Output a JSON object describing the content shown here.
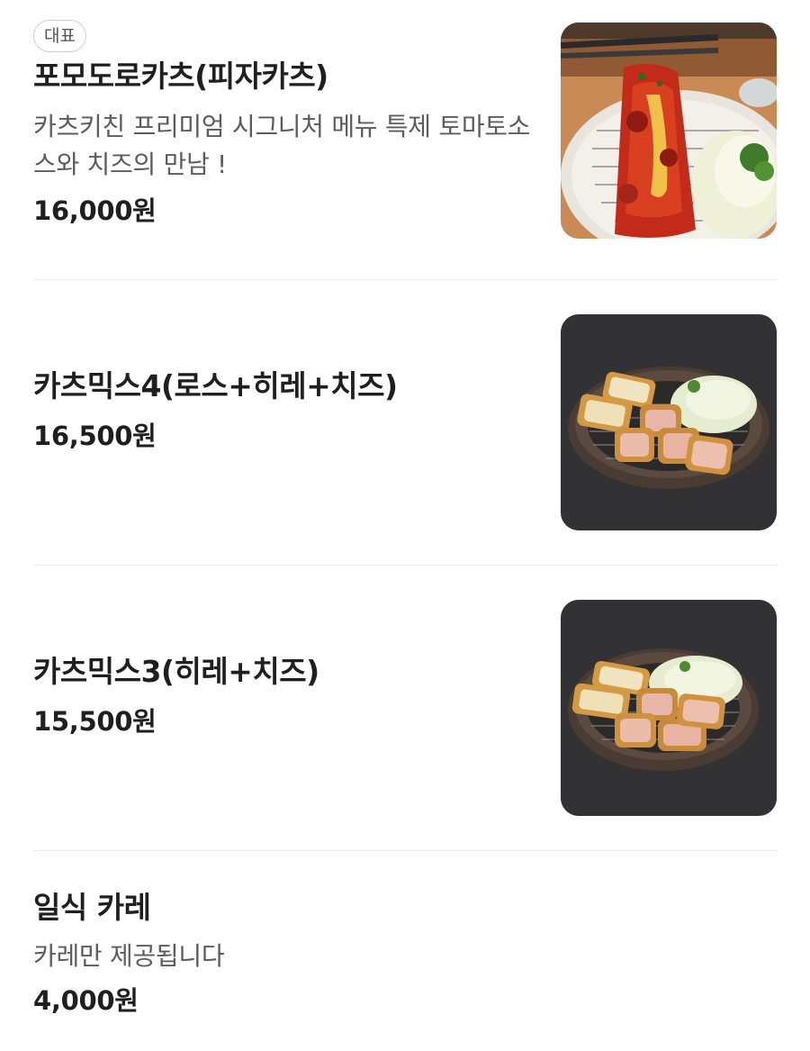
{
  "menu": {
    "items": [
      {
        "badge": "대표",
        "name": "포모도로카츠(피자카츠)",
        "description": "카츠키친 프리미엄 시그니처 메뉴 특제 토마토소스와 치즈의 만남 !",
        "price": "16,000원",
        "image_icon": "pizza-katsu-photo"
      },
      {
        "name": "카츠믹스4(로스+히레+치즈)",
        "price": "16,500원",
        "image_icon": "katsu-mix-4-photo"
      },
      {
        "name": "카츠믹스3(히레+치즈)",
        "price": "15,500원",
        "image_icon": "katsu-mix-3-photo"
      },
      {
        "name": "일식 카레",
        "description": "카레만 제공됩니다",
        "price": "4,000원"
      }
    ]
  },
  "colors": {
    "text_primary": "#1f1f1f",
    "text_secondary": "#5c5c5c",
    "divider": "#ececec",
    "badge_border": "#cfcfcf"
  }
}
